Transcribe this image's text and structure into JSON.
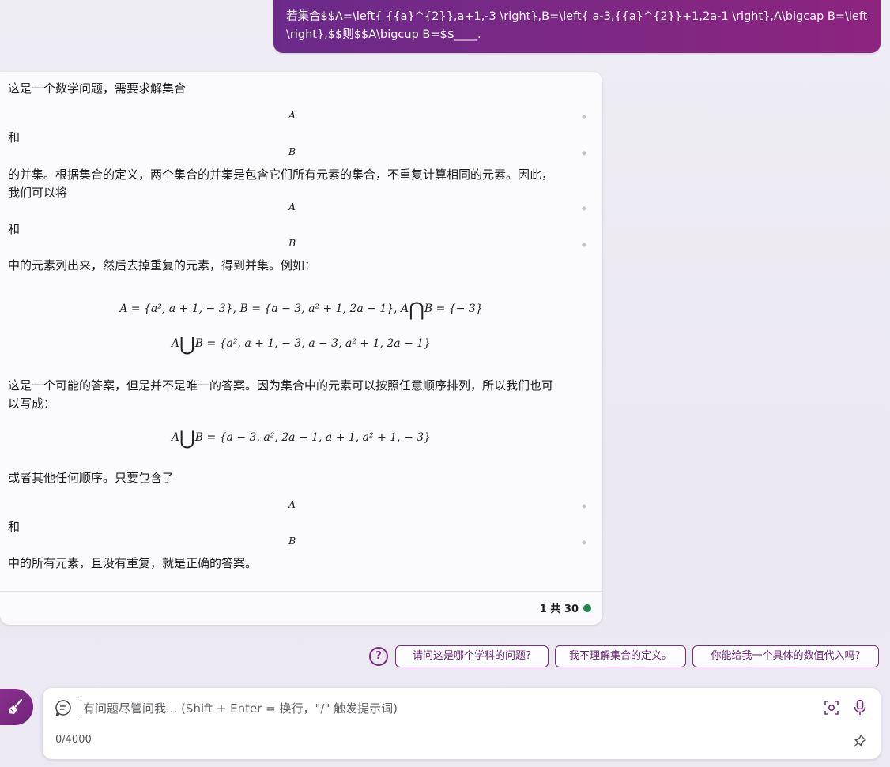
{
  "user_message": {
    "line1": "若集合$$A=\\left{ {{a}^{2}},a+1,-3 \\right},B=\\left{ a-3,{{a}^{2}}+1,2a-1 \\right},A\\bigcap B=\\left{ -3",
    "line2": "\\right},$$则$$A\\bigcup B=$$____."
  },
  "answer": {
    "p1": "这是一个数学问题，需要求解集合",
    "var_a": "A",
    "var_b": "B",
    "and": "和",
    "p2a": "的并集。根据集合的定义，两个集合的并集是包含它们所有元素的集合，不重复计算相同的元素。因此，",
    "p2b": "我们可以将",
    "p3": "中的元素列出来，然后去掉重复的元素，得到并集。例如：",
    "eq1": {
      "a_def": "A = {a², a + 1, − 3}",
      "b_def": "B = {a − 3, a² + 1, 2a − 1}",
      "inter_left": "A",
      "inter_right": "B = {− 3}"
    },
    "eq2": {
      "left": "A",
      "right": "B = {a², a + 1, − 3, a − 3, a² + 1, 2a − 1}"
    },
    "p4a": "这是一个可能的答案，但是并不是唯一的答案。因为集合中的元素可以按照任意顺序排列，所以我们也可",
    "p4b": "以写成：",
    "eq3": {
      "left": "A",
      "right": "B = {a − 3, a², 2a − 1, a + 1, a² + 1, − 3}"
    },
    "p5": "或者其他任何顺序。只要包含了",
    "p6": "中的所有元素，且没有重复，就是正确的答案。",
    "counter": "1 共 30"
  },
  "suggestions": [
    "请问这是哪个学科的问题?",
    "我不理解集合的定义。",
    "你能给我一个具体的数值代入吗?"
  ],
  "input": {
    "placeholder": "有问题尽管问我... (Shift + Enter = 换行，\"/\" 触发提示词)",
    "char_count": "0/4000"
  },
  "colors": {
    "accent": "#7d2883",
    "status_green": "#1f8a4c"
  },
  "icons": {
    "help": "help-circle-icon",
    "avatar": "broom-icon",
    "chat": "chat-bubble-icon",
    "scan": "scan-icon",
    "mic": "microphone-icon",
    "pin": "pin-icon"
  }
}
